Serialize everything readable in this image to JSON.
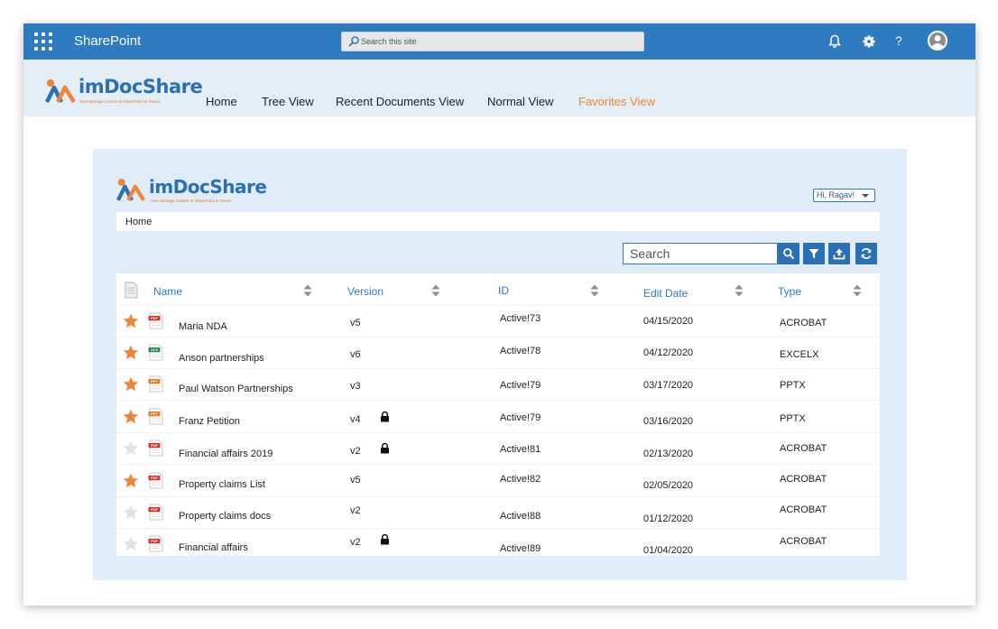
{
  "suitebar": {
    "title": "SharePoint",
    "search_placeholder": "Search this site",
    "help_label": "?"
  },
  "brand": {
    "name": "imDocShare",
    "tagline": "Your Manage content in SharePoint & Teams",
    "colors": {
      "blue": "#2b6fb6",
      "orange": "#e8792b",
      "suitebar": "#2f7bc2"
    }
  },
  "nav": [
    {
      "label": "Home",
      "active": false
    },
    {
      "label": "Tree View",
      "active": false
    },
    {
      "label": "Recent Documents View",
      "active": false
    },
    {
      "label": "Normal View",
      "active": false
    },
    {
      "label": "Favorites View",
      "active": true
    }
  ],
  "user_menu": {
    "label": "Hi, Ragav!"
  },
  "breadcrumb": {
    "label": "Home"
  },
  "search": {
    "placeholder": "Search"
  },
  "toolbar_icons": [
    "search-icon",
    "filter-icon",
    "upload-icon",
    "refresh-icon"
  ],
  "table": {
    "columns": [
      "Name",
      "Version",
      "ID",
      "Edit Date",
      "Type"
    ],
    "rows": [
      {
        "favorite": true,
        "filetype": "PDF",
        "name": "Maria NDA",
        "version": "v5",
        "locked": false,
        "id": "Active!73",
        "date": "04/15/2020",
        "type": "ACROBAT"
      },
      {
        "favorite": true,
        "filetype": "XLS",
        "name": "Anson partnerships",
        "version": "v6",
        "locked": false,
        "id": "Active!78",
        "date": "04/12/2020",
        "type": "EXCELX"
      },
      {
        "favorite": true,
        "filetype": "PPT",
        "name": "Paul Watson Partnerships",
        "version": "v3",
        "locked": false,
        "id": "Active!79",
        "date": "03/17/2020",
        "type": "PPTX"
      },
      {
        "favorite": true,
        "filetype": "PPT",
        "name": "Franz Petition",
        "version": "v4",
        "locked": true,
        "id": "Active!79",
        "date": "03/16/2020",
        "type": "PPTX"
      },
      {
        "favorite": false,
        "filetype": "PDF",
        "name": "Financial affairs  2019",
        "version": "v2",
        "locked": true,
        "id": "Active!81",
        "date": "02/13/2020",
        "type": "ACROBAT"
      },
      {
        "favorite": true,
        "filetype": "PDF",
        "name": "Property claims List",
        "version": "v5",
        "locked": false,
        "id": "Active!82",
        "date": "02/05/2020",
        "type": "ACROBAT"
      },
      {
        "favorite": false,
        "filetype": "PDF",
        "name": "Property claims docs",
        "version": "v2",
        "locked": false,
        "id": "Active!88",
        "date": "01/12/2020",
        "type": "ACROBAT"
      },
      {
        "favorite": false,
        "filetype": "PDF",
        "name": "Financial affairs",
        "version": "v2",
        "locked": true,
        "id": "Active!89",
        "date": "01/04/2020",
        "type": "ACROBAT"
      }
    ]
  }
}
